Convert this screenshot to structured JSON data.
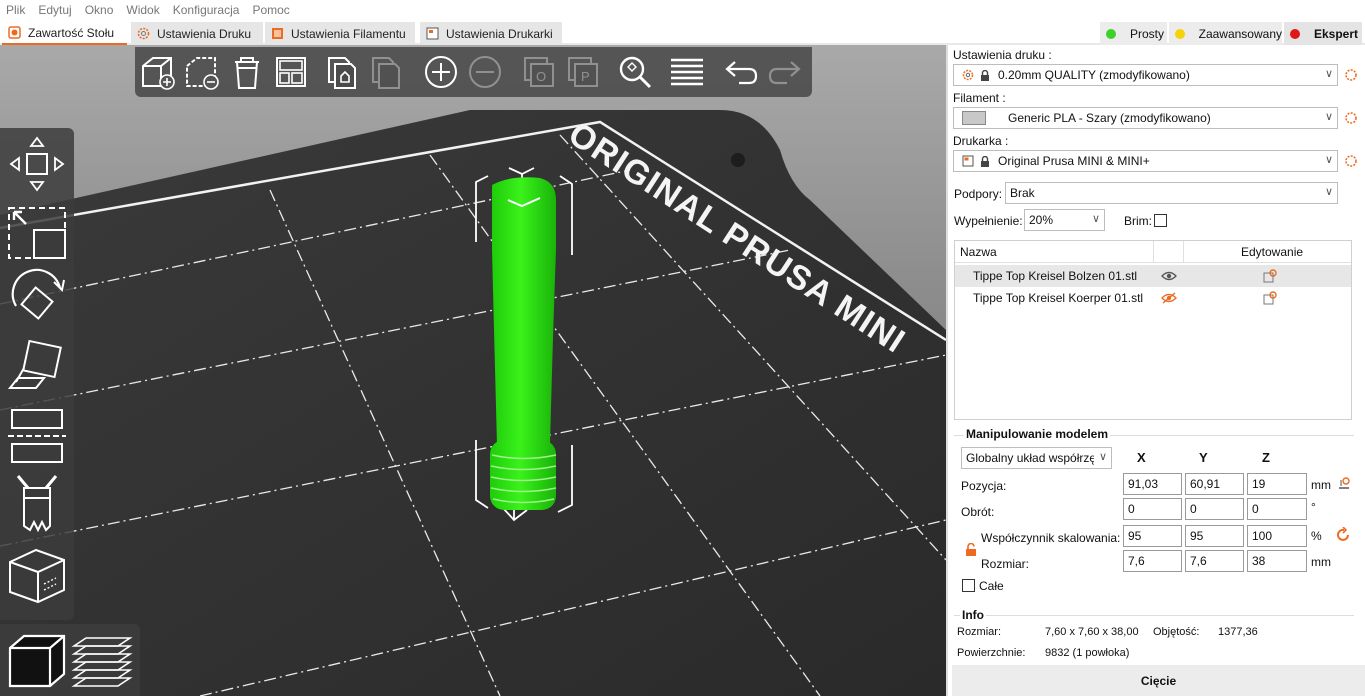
{
  "menu": [
    "Plik",
    "Edytuj",
    "Okno",
    "Widok",
    "Konfiguracja",
    "Pomoc"
  ],
  "tabs": [
    {
      "label": "Zawartość Stołu"
    },
    {
      "label": "Ustawienia Druku"
    },
    {
      "label": "Ustawienia Filamentu"
    },
    {
      "label": "Ustawienia Drukarki"
    }
  ],
  "modes": [
    {
      "label": "Prosty",
      "color": "#3dd12a"
    },
    {
      "label": "Zaawansowany",
      "color": "#f5d30a"
    },
    {
      "label": "Ekspert",
      "color": "#e01717"
    }
  ],
  "bed": {
    "label": "ORIGINAL PRUSA MINI"
  },
  "colors": {
    "accent": "#ed6b21",
    "model": "#2ee80f",
    "bed": "#2f2f2f"
  },
  "sidebar": {
    "print_label": "Ustawienia druku :",
    "print_value": "0.20mm QUALITY (zmodyfikowano)",
    "filament_label": "Filament :",
    "filament_value": "Generic PLA - Szary (zmodyfikowano)",
    "filament_swatch": "#c8c8c8",
    "printer_label": "Drukarka :",
    "printer_value": "Original Prusa MINI & MINI+",
    "supports_label": "Podpory:",
    "supports_value": "Brak",
    "infill_label": "Wypełnienie:",
    "infill_value": "20%",
    "brim_label": "Brim:"
  },
  "objects": {
    "col_name": "Nazwa",
    "col_edit": "Edytowanie",
    "rows": [
      {
        "name": "Tippe Top Kreisel Bolzen 01.stl",
        "visible": true
      },
      {
        "name": "Tippe Top Kreisel Koerper 01.stl",
        "visible": false
      }
    ]
  },
  "manip": {
    "title": "Manipulowanie modelem",
    "coord_system": "Globalny układ współrzę",
    "axes": [
      "X",
      "Y",
      "Z"
    ],
    "position_label": "Pozycja:",
    "position": [
      "91,03",
      "60,91",
      "19"
    ],
    "position_unit": "mm",
    "rotation_label": "Obrót:",
    "rotation": [
      "0",
      "0",
      "0"
    ],
    "rotation_unit": "°",
    "scale_label": "Współczynnik skalowania:",
    "scale": [
      "95",
      "95",
      "100"
    ],
    "scale_unit": "%",
    "size_label": "Rozmiar:",
    "size": [
      "7,6",
      "7,6",
      "38"
    ],
    "size_unit": "mm",
    "whole_label": "Całe"
  },
  "info": {
    "title": "Info",
    "size_label": "Rozmiar:",
    "size_value": "7,60 x 7,60 x 38,00",
    "volume_label": "Objętość:",
    "volume_value": "1377,36",
    "surfaces_label": "Powierzchnie:",
    "surfaces_value": "9832 (1 powłoka)"
  },
  "slice_button": "Cięcie"
}
